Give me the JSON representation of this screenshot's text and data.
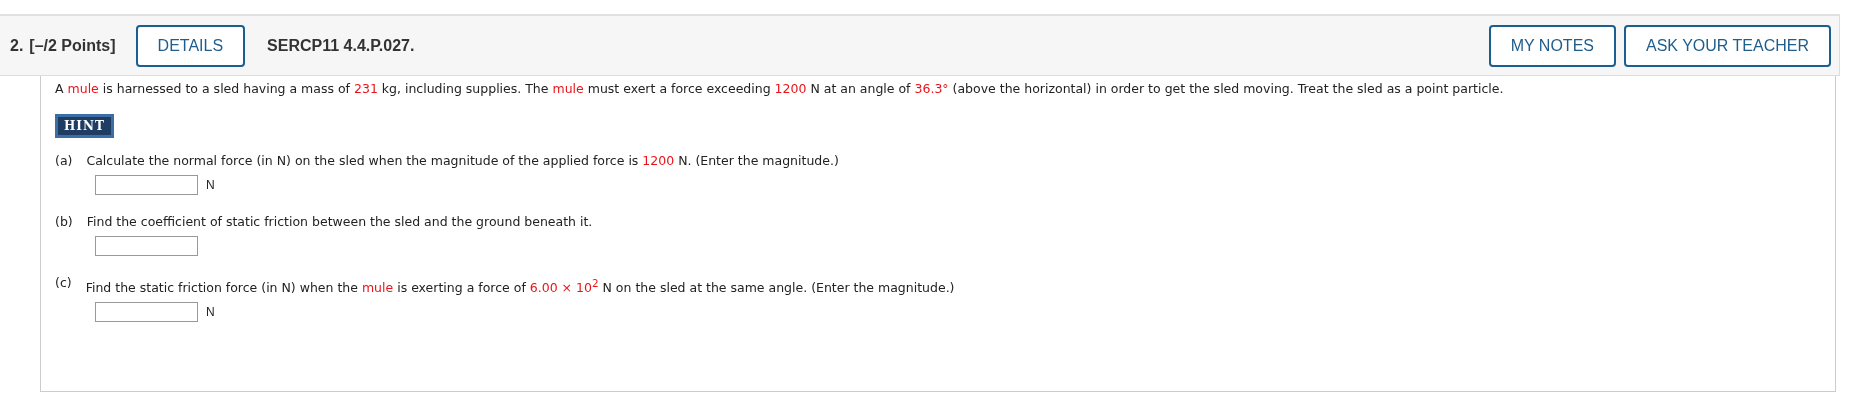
{
  "header": {
    "number": "2.",
    "points": "[–/2 Points]",
    "details_button": "DETAILS",
    "problem_id": "SERCP11 4.4.P.027.",
    "buttons": [
      "MY NOTES",
      "ASK YOUR TEACHER"
    ]
  },
  "question": [
    {
      "text": "A ",
      "highlight": false
    },
    {
      "text": "mule",
      "highlight": true
    },
    {
      "text": " is harnessed to a sled having a mass of ",
      "highlight": false
    },
    {
      "text": "231",
      "highlight": true
    },
    {
      "text": " kg, including supplies. The ",
      "highlight": false
    },
    {
      "text": "mule",
      "highlight": true
    },
    {
      "text": " must exert a force exceeding ",
      "highlight": false
    },
    {
      "text": "1200",
      "highlight": true
    },
    {
      "text": " N at an angle of ",
      "highlight": false
    },
    {
      "text": "36.3°",
      "highlight": true
    },
    {
      "text": " (above the horizontal) in order to get the sled moving. Treat the sled as a point particle.",
      "highlight": false
    }
  ],
  "hint_button": "HINT",
  "parts": [
    {
      "label": "(a)",
      "segments": [
        {
          "text": "Calculate the normal force (in N) on the sled when the magnitude of the applied force is ",
          "highlight": false
        },
        {
          "text": "1200",
          "highlight": true
        },
        {
          "text": " N. (Enter the magnitude.)",
          "highlight": false
        }
      ],
      "unit": "N"
    },
    {
      "label": "(b)",
      "segments": [
        {
          "text": "Find the coefficient of static friction between the sled and the ground beneath it.",
          "highlight": false
        }
      ]
    },
    {
      "label": "(c)",
      "segments": [
        {
          "text": "Find the static friction force (in N) when the ",
          "highlight": false
        },
        {
          "text": "mule",
          "highlight": true
        },
        {
          "text": " is exerting a force of ",
          "highlight": false
        },
        {
          "text": "6.00 × 10$^{2}$",
          "highlight": true
        },
        {
          "text": " N on the sled at the same angle. (Enter the magnitude.)",
          "highlight": false
        }
      ],
      "unit": "N"
    }
  ]
}
